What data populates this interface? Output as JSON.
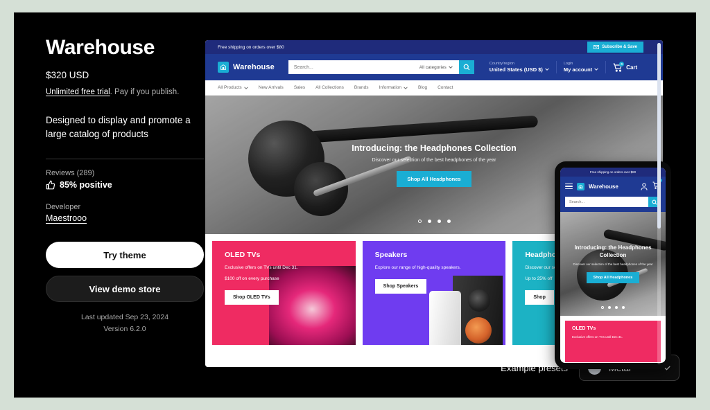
{
  "colors": {
    "page_background": "#d5e0d6",
    "panel": "#000000",
    "brand_blue": "#1f3a93",
    "announce_blue": "#1f2b7b",
    "accent_cyan": "#1aaed4",
    "card_pink": "#ef2b62",
    "card_purple": "#6f3cf0",
    "card_teal": "#1cb2c4",
    "swatch": "#ced4dc"
  },
  "theme": {
    "title": "Warehouse",
    "price": "$320 USD",
    "trial_link": "Unlimited free trial",
    "trial_rest": ". Pay if you publish.",
    "tagline": "Designed to display and promote a large catalog of products",
    "reviews_label": "Reviews (289)",
    "reviews_score": "85% positive",
    "developer_label": "Developer",
    "developer_name": "Maestrooo",
    "try_button": "Try theme",
    "demo_button": "View demo store",
    "last_updated": "Last updated Sep 23, 2024",
    "version": "Version 6.2.0"
  },
  "presets": {
    "label": "Example presets",
    "selected": "Metal"
  },
  "store": {
    "announcement": "Free shipping on orders over $80",
    "subscribe_button": "Subscribe & Save",
    "brand": "Warehouse",
    "search_placeholder": "Search...",
    "category_selector": "All categories",
    "country_label": "Country/region",
    "country_value": "United States (USD $)",
    "login_label": "Login",
    "login_value": "My account",
    "cart_label": "Cart",
    "cart_count": "0",
    "nav": [
      {
        "label": "All Products",
        "caret": true
      },
      {
        "label": "New Arrivals",
        "caret": false
      },
      {
        "label": "Sales",
        "caret": false
      },
      {
        "label": "All Collections",
        "caret": false
      },
      {
        "label": "Brands",
        "caret": false
      },
      {
        "label": "Information",
        "caret": true
      },
      {
        "label": "Blog",
        "caret": false
      },
      {
        "label": "Contact",
        "caret": false
      }
    ],
    "hero": {
      "title": "Introducing: the Headphones Collection",
      "subtitle": "Discover our selection of the best headphones of the year",
      "button": "Shop All Headphones",
      "slides": 4,
      "active_slide": 1
    },
    "cards": [
      {
        "title": "OLED TVs",
        "line1": "Exclusive offers on TVs until Dec 31.",
        "line2": "$100 off on every purchase",
        "button": "Shop OLED TVs",
        "color": "#ef2b62"
      },
      {
        "title": "Speakers",
        "line1": "Explore our range of high-quality speakers.",
        "line2": "",
        "button": "Shop Speakers",
        "color": "#6f3cf0"
      },
      {
        "title": "Headphones",
        "line1": "Discover our selection",
        "line2": "Up to 25% off",
        "button": "Shop",
        "color": "#1cb2c4"
      }
    ]
  },
  "mobile": {
    "announcement": "Free shipping on orders over $80",
    "brand": "Warehouse",
    "search_placeholder": "Search...",
    "cart_count": "0",
    "hero_title": "Introducing: the Headphones Collection",
    "hero_subtitle": "Discover our selection of the best headphones of the year",
    "hero_button": "Shop All Headphones",
    "slides": 4,
    "active_slide": 1,
    "card_title": "OLED TVs",
    "card_line": "Exclusive offers on TVs until Dec 31."
  }
}
